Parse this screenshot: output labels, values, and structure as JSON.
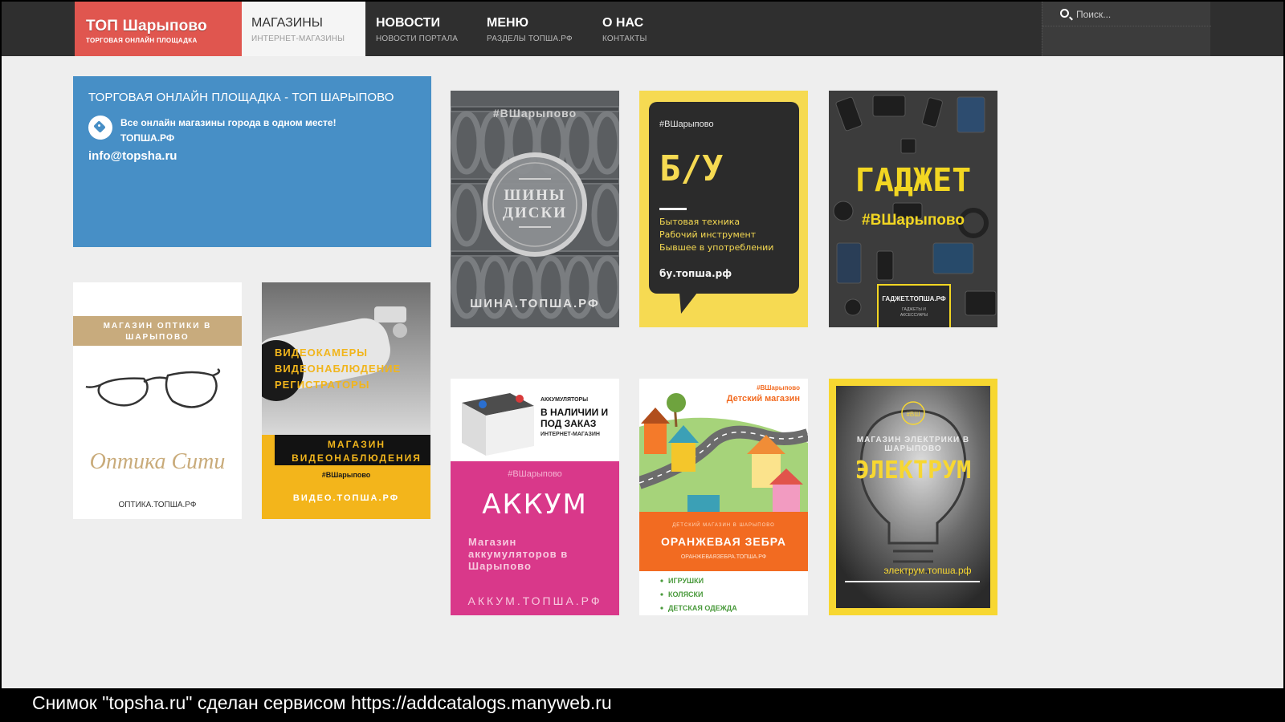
{
  "header": {
    "logo": {
      "title": "ТОП Шарыпово",
      "subtitle": "ТОРГОВАЯ ОНЛАЙН ПЛОЩАДКА"
    },
    "nav": [
      {
        "title": "МАГАЗИНЫ",
        "sub": "ИНТЕРНЕТ-МАГАЗИНЫ",
        "active": true
      },
      {
        "title": "НОВОСТИ",
        "sub": "НОВОСТИ ПОРТАЛА"
      },
      {
        "title": "МЕНЮ",
        "sub": "РАЗДЕЛЫ ТОПША.РФ"
      },
      {
        "title": "О НАС",
        "sub": "КОНТАКТЫ"
      }
    ],
    "search": {
      "placeholder": "Поиск..."
    }
  },
  "info": {
    "title": "ТОРГОВАЯ ОНЛАЙН ПЛОЩАДКА - ТОП ШАРЫПОВО",
    "line1": "Все онлайн магазины города в одном месте!",
    "line2": "ТОПША.РФ",
    "email": "info@topsha.ru"
  },
  "tiles": {
    "shina": {
      "hashtag": "#ВШарыпово",
      "line1": "ШИНЫ",
      "line2": "ДИСКИ",
      "site": "ШИНА.ТОПША.РФ"
    },
    "bu": {
      "hashtag": "#ВШарыпово",
      "title": "Б/У",
      "l1": "Бытовая техника",
      "l2": "Рабочий инструмент",
      "l3": "Бывшее в употреблении",
      "site": "бу.топша.рф"
    },
    "gadget": {
      "title": "ГАДЖЕТ",
      "hashtag": "#ВШарыпово",
      "site": "ГАДЖЕТ.ТОПША.РФ",
      "small": "ГАДЖЕТЫ И",
      "small2": "АКСЕССУАРЫ"
    },
    "optika": {
      "banner1": "МАГАЗИН ОПТИКИ В",
      "banner2": "ШАРЫПОВО",
      "name": "Оптика Сити",
      "site": "ОПТИКА.ТОПША.РФ"
    },
    "video": {
      "l1": "ВИДЕОКАМЕРЫ",
      "l2": "ВИДЕОНАБЛЮДЕНИЕ",
      "l3": "РЕГИСТРАТОРЫ",
      "b1": "МАГАЗИН",
      "b2": "ВИДЕОНАБЛЮДЕНИЯ",
      "hashtag": "#ВШарыпово",
      "site": "ВИДЕО.ТОПША.РФ"
    },
    "akkum": {
      "top0": "АККУМУЛЯТОРЫ",
      "top1": "В НАЛИЧИИ И",
      "top2": "ПОД ЗАКАЗ",
      "top3": "ИНТЕРНЕТ-МАГАЗИН",
      "hashtag": "#ВШарыпово",
      "title": "АККУМ",
      "d1": "Магазин",
      "d2": "аккумуляторов в",
      "d3": "Шарыпово",
      "site": "АККУМ.ТОПША.РФ"
    },
    "zebra": {
      "hashtag": "#ВШарыпово",
      "title": "Детский магазин",
      "small": "ДЕТСКИЙ МАГАЗИН В ШАРЫПОВО",
      "name": "ОРАНЖЕВАЯ ЗЕБРА",
      "site": "ОРАНЖЕВАЯЗЕБРА.ТОПША.РФ",
      "i1": "ИГРУШКИ",
      "i2": "КОЛЯСКИ",
      "i3": "ДЕТСКАЯ ОДЕЖДА"
    },
    "elektrum": {
      "badge": "#ВШ",
      "sub1": "МАГАЗИН ЭЛЕКТРИКИ В",
      "sub2": "ШАРЫПОВО",
      "title": "ЭЛЕКТРУМ",
      "site": "электрум.топша.рф"
    }
  },
  "caption": "Снимок \"topsha.ru\" сделан сервисом https://addcatalogs.manyweb.ru"
}
